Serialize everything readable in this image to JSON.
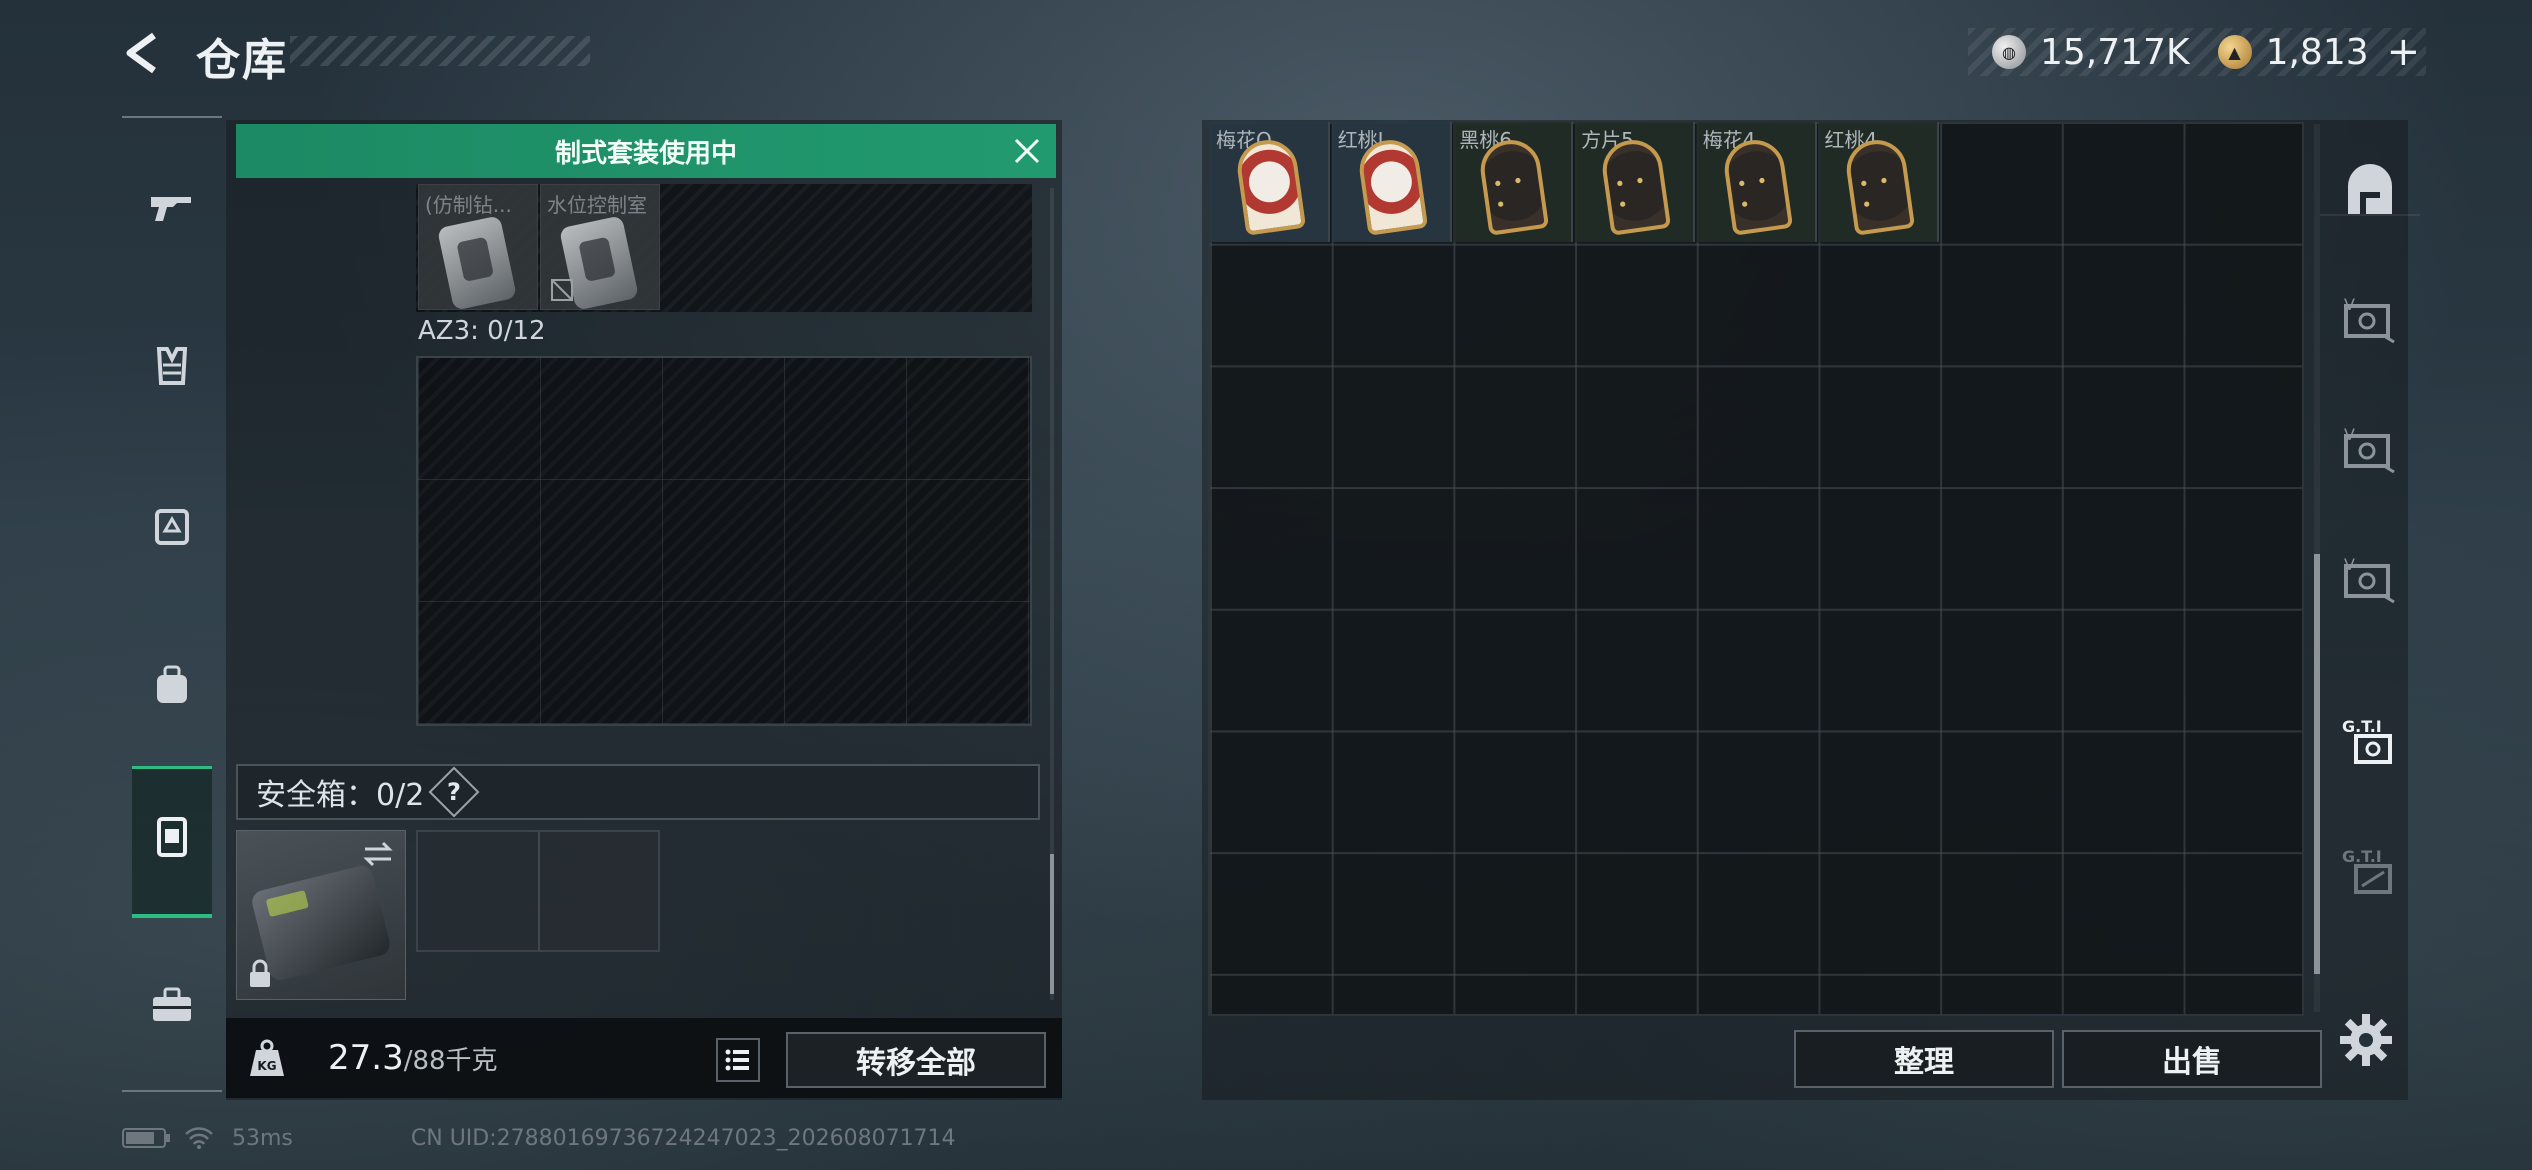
{
  "header": {
    "title": "仓库",
    "currencies": [
      {
        "icon": "silver-coin-icon",
        "value": "15,717K"
      },
      {
        "icon": "gold-coin-icon",
        "value": "1,813"
      }
    ],
    "add_label": "+"
  },
  "rail": {
    "items": [
      "weapon-icon",
      "vest-icon",
      "armor-icon",
      "backpack-icon",
      "safebox-icon",
      "toolbox-icon"
    ],
    "active": "safebox-icon"
  },
  "loadout": {
    "banner": "制式套装使用中",
    "top_items": [
      {
        "label": "(仿制钻..."
      },
      {
        "label": "水位控制室"
      }
    ],
    "az3_label": "AZ3: 0/12",
    "safebox_label": "安全箱：0/2",
    "help_label": "?",
    "weight_value": "27.3",
    "weight_cap": "/88千克",
    "transfer_all": "转移全部"
  },
  "stash": {
    "cards": [
      {
        "label": "梅花Q",
        "style": "red"
      },
      {
        "label": "红桃J",
        "style": "red"
      },
      {
        "label": "黑桃6",
        "style": "dark"
      },
      {
        "label": "方片5",
        "style": "dark"
      },
      {
        "label": "梅花4",
        "style": "dark"
      },
      {
        "label": "红桃4",
        "style": "dark"
      }
    ],
    "sort_label": "整理",
    "sell_label": "出售",
    "tabs": [
      "home-tab-icon",
      "vip-stash-icon-1",
      "vip-stash-icon-2",
      "vip-stash-icon-3",
      "gti-stash-icon-1",
      "gti-stash-icon-2"
    ]
  },
  "status": {
    "ping": "53ms",
    "uid": "CN UID:27880169736724247023_202608071714"
  },
  "colors": {
    "accent_green": "#229a70",
    "text_main": "#eef1f3"
  }
}
